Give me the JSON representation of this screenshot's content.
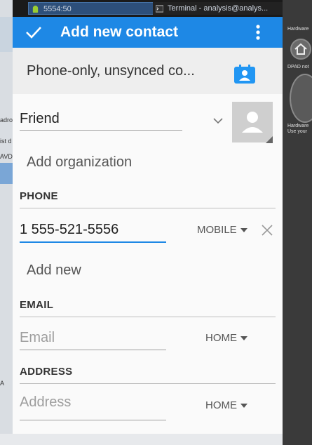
{
  "taskbar": {
    "task1": "5554:50",
    "task2": "Terminal - analysis@analys..."
  },
  "side_window": {
    "fragments": [
      "adro",
      "ist d",
      "AVD",
      "A"
    ]
  },
  "emulator_panel": {
    "hardware_label": "Hardware",
    "dpad_label": "DPAD not",
    "hardware_bottom_1": "Hardware",
    "hardware_bottom_2": "Use your"
  },
  "app_bar": {
    "title": "Add new contact",
    "confirm_icon": "check-icon",
    "menu_icon": "more-vert-icon"
  },
  "account": {
    "label": "Phone-only, unsynced co...",
    "icon": "contact-card-icon"
  },
  "name": {
    "value": "Friend"
  },
  "organization": {
    "label": "Add organization"
  },
  "phone": {
    "section": "PHONE",
    "value": "1 555-521-5556",
    "type": "MOBILE",
    "add_new": "Add new"
  },
  "email": {
    "section": "EMAIL",
    "placeholder": "Email",
    "type": "HOME"
  },
  "address": {
    "section": "ADDRESS",
    "placeholder": "Address",
    "type": "HOME"
  },
  "colors": {
    "accent": "#1e88e5",
    "app_bar": "#1e88e5",
    "focus_underline": "#1e88e5"
  }
}
